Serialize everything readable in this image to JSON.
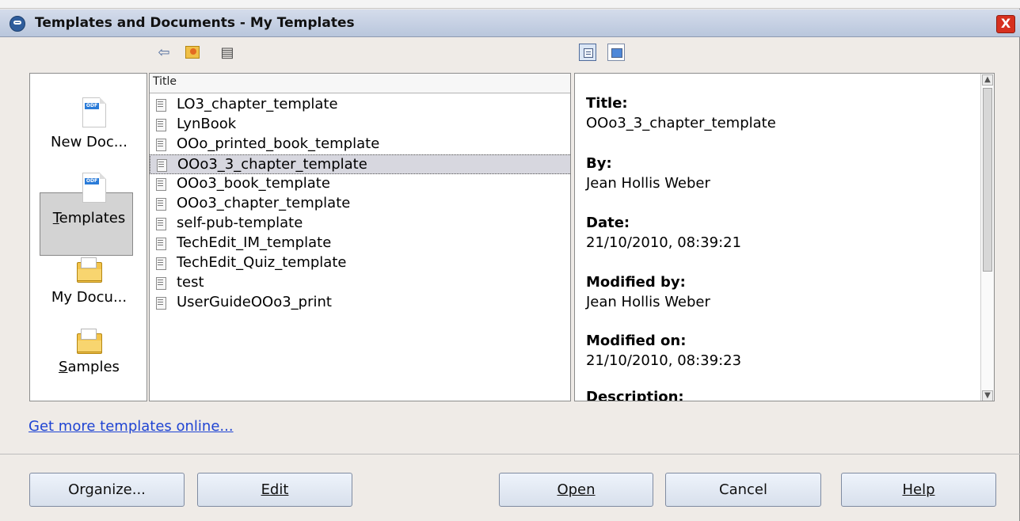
{
  "window": {
    "title": "Templates and Documents - My Templates",
    "close_label": "X"
  },
  "toolbar": {
    "back_icon": "back-arrow-icon",
    "up_icon": "folder-up-icon",
    "print_icon": "print-icon",
    "document_properties_icon": "document-properties-icon",
    "preview_icon": "preview-icon"
  },
  "left_pane": {
    "items": [
      {
        "label": "New Doc...",
        "icon": "new-document-icon"
      },
      {
        "label": "Templates",
        "icon": "templates-icon",
        "selected": true
      },
      {
        "label": "My Docu...",
        "icon": "my-documents-icon"
      },
      {
        "label": "Samples",
        "icon": "samples-icon"
      }
    ]
  },
  "template_list": {
    "header": "Title",
    "items": [
      "LO3_chapter_template",
      "LynBook",
      "OOo_printed_book_template",
      "OOo3_3_chapter_template",
      "OOo3_book_template",
      "OOo3_chapter_template",
      "self-pub-template",
      "TechEdit_IM_template",
      "TechEdit_Quiz_template",
      "test",
      "UserGuideOOo3_print"
    ],
    "selected_index": 3
  },
  "details": {
    "title_label": "Title:",
    "title_value": "OOo3_3_chapter_template",
    "by_label": "By:",
    "by_value": "Jean Hollis Weber",
    "date_label": "Date:",
    "date_value": "21/10/2010, 08:39:21",
    "modified_by_label": "Modified by:",
    "modified_by_value": "Jean Hollis Weber",
    "modified_on_label": "Modified on:",
    "modified_on_value": "21/10/2010, 08:39:23",
    "description_label": "Description:"
  },
  "link_text": "Get more templates online...",
  "buttons": {
    "organize": "Organize...",
    "edit": "Edit",
    "open": "Open",
    "cancel": "Cancel",
    "help": "Help"
  }
}
